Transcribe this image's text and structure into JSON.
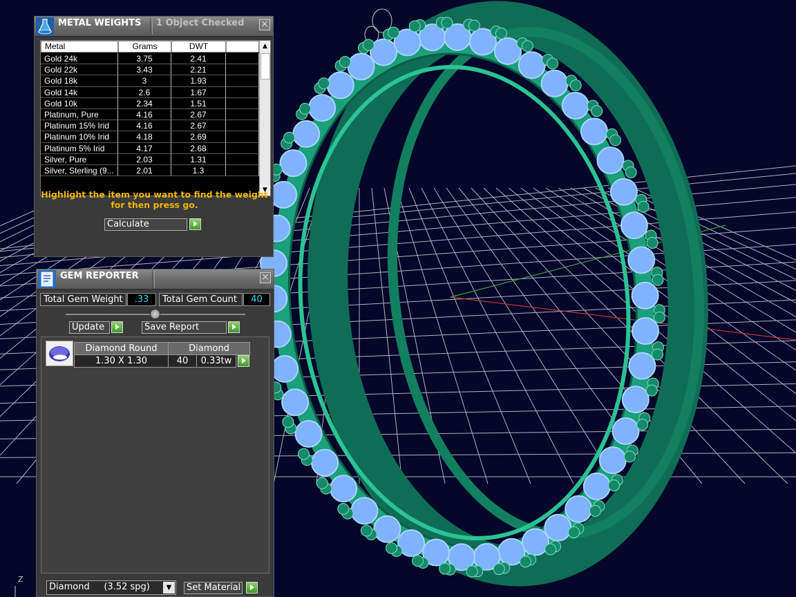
{
  "viewport": {
    "axis_label": "Z",
    "colors": {
      "ring": "#1aa07a",
      "stone": "#7fb2ff",
      "prong": "#158a6a",
      "grid": "#cfd2d8",
      "background": "#04062a"
    }
  },
  "metal_weights": {
    "title": "METAL WEIGHTS",
    "status": "1 Object Checked",
    "icon": "flask-icon",
    "columns": [
      "Metal",
      "Grams",
      "DWT"
    ],
    "rows": [
      {
        "metal": "Gold 24k",
        "grams": "3.75",
        "dwt": "2.41"
      },
      {
        "metal": "Gold 22k",
        "grams": "3.43",
        "dwt": "2.21"
      },
      {
        "metal": "Gold 18k",
        "grams": "3",
        "dwt": "1.93"
      },
      {
        "metal": "Gold 14k",
        "grams": "2.6",
        "dwt": "1.67"
      },
      {
        "metal": "Gold 10k",
        "grams": "2.34",
        "dwt": "1.51"
      },
      {
        "metal": "Platinum, Pure",
        "grams": "4.16",
        "dwt": "2.67"
      },
      {
        "metal": "Platinum 15% Irid",
        "grams": "4.16",
        "dwt": "2.67"
      },
      {
        "metal": "Platinum 10% Irid",
        "grams": "4.18",
        "dwt": "2.69"
      },
      {
        "metal": "Platinum 5% Irid",
        "grams": "4.17",
        "dwt": "2.68"
      },
      {
        "metal": "Silver, Pure",
        "grams": "2.03",
        "dwt": "1.31"
      },
      {
        "metal": "Silver, Sterling (9...",
        "grams": "2.01",
        "dwt": "1.3"
      }
    ],
    "hint": "Highlight the item you want to find the weight for then press go.",
    "action_select": "Calculate"
  },
  "gem_reporter": {
    "title": "GEM REPORTER",
    "icon": "report-icon",
    "total_weight_label": "Total Gem Weight",
    "total_weight_value": ".33",
    "total_count_label": "Total Gem Count",
    "total_count_value": "40",
    "update_label": "Update",
    "save_label": "Save Report",
    "gems": [
      {
        "shape": "Diamond Round",
        "material": "Diamond",
        "size": "1.30 X 1.30",
        "count": "40",
        "weight": "0.33tw"
      }
    ],
    "material_select": "Diamond     (3.52 spg)",
    "set_material_label": "Set Material"
  }
}
